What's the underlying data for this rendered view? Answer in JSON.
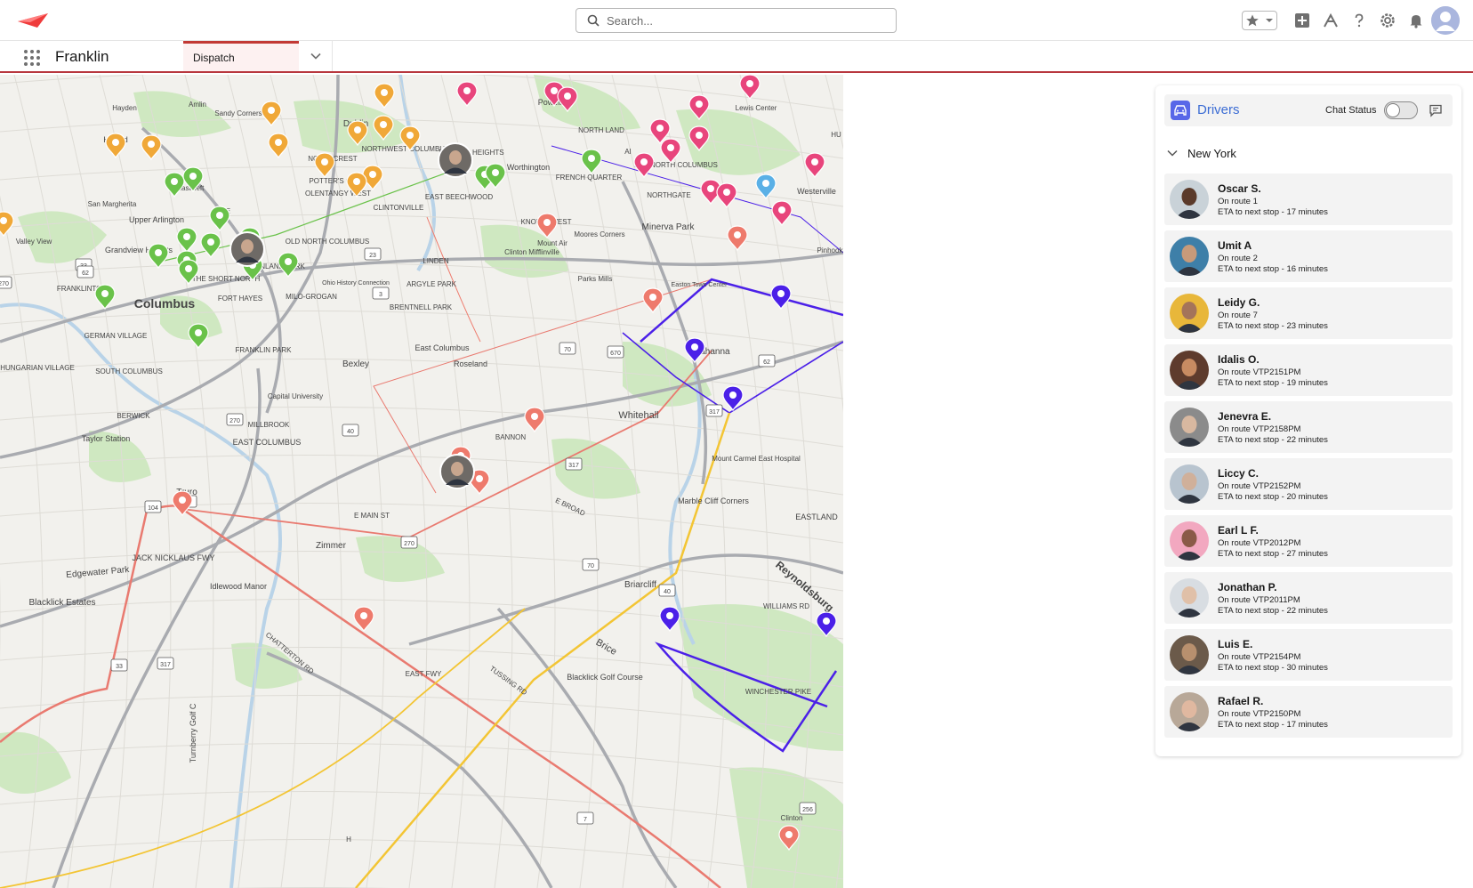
{
  "header": {
    "search_placeholder": "Search...",
    "icons": [
      "star-icon",
      "chevron-down-icon",
      "add-icon",
      "trailhead-icon",
      "help-icon",
      "gear-icon",
      "bell-icon",
      "user-avatar-icon"
    ]
  },
  "app": {
    "name": "Franklin",
    "active_tab": "Dispatch"
  },
  "map": {
    "labels": [
      {
        "text": "Hayden",
        "size": 8
      },
      {
        "text": "Amlin",
        "size": 8
      },
      {
        "text": "Sandy Corners",
        "size": 8
      },
      {
        "text": "Dublin",
        "size": 10
      },
      {
        "text": "Powell",
        "size": 9
      },
      {
        "text": "Lewis Center",
        "size": 8
      },
      {
        "text": "Hilliard",
        "size": 9
      },
      {
        "text": "Eastcleft",
        "size": 8
      },
      {
        "text": "NORTHWEST COLUMBUS",
        "size": 8
      },
      {
        "text": "Worthington",
        "size": 9
      },
      {
        "text": "FAR NORTH COLUMBUS",
        "size": 8
      },
      {
        "text": "Westerville",
        "size": 9
      },
      {
        "text": "San Margherita",
        "size": 8
      },
      {
        "text": "Upper Arlington",
        "size": 9
      },
      {
        "text": "OLENTANGY WEST",
        "size": 8
      },
      {
        "text": "CLINTONVILLE",
        "size": 8
      },
      {
        "text": "EAST BEECHWOOD",
        "size": 8
      },
      {
        "text": "FRENCH QUARTER",
        "size": 8
      },
      {
        "text": "NORTHGATE",
        "size": 8
      },
      {
        "text": "Minerva Park",
        "size": 10
      },
      {
        "text": "Valley View",
        "size": 8
      },
      {
        "text": "Grandview Heights",
        "size": 9
      },
      {
        "text": "OLD NORTH COLUMBUS",
        "size": 8
      },
      {
        "text": "LINDEN",
        "size": 8
      },
      {
        "text": "Clinton Mifflinville",
        "size": 8
      },
      {
        "text": "Moores Corners",
        "size": 8
      },
      {
        "text": "Pinhook",
        "size": 8
      },
      {
        "text": "FRANKLINTON",
        "size": 8
      },
      {
        "text": "THE SHORT NORTH",
        "size": 8
      },
      {
        "text": "WEINLAND PARK",
        "size": 8
      },
      {
        "text": "Ohio History Connection",
        "size": 7
      },
      {
        "text": "ARGYLE PARK",
        "size": 8
      },
      {
        "text": "Parks Mills",
        "size": 8
      },
      {
        "text": "Easton Town Center",
        "size": 7
      },
      {
        "text": "Columbus",
        "size": 14
      },
      {
        "text": "FORT HAYES",
        "size": 8
      },
      {
        "text": "MILO-GROGAN",
        "size": 8
      },
      {
        "text": "BRENTNELL PARK",
        "size": 8
      },
      {
        "text": "Gahanna",
        "size": 10
      },
      {
        "text": "GERMAN VILLAGE",
        "size": 8
      },
      {
        "text": "HUNGARIAN VILLAGE",
        "size": 8
      },
      {
        "text": "SOUTH COLUMBUS",
        "size": 8
      },
      {
        "text": "FRANKLIN PARK",
        "size": 8
      },
      {
        "text": "Bexley",
        "size": 10
      },
      {
        "text": "East Columbus",
        "size": 9
      },
      {
        "text": "Roseland",
        "size": 9
      },
      {
        "text": "Capital University",
        "size": 8
      },
      {
        "text": "MILLBROOK",
        "size": 8
      },
      {
        "text": "BERWICK",
        "size": 8
      },
      {
        "text": "EAST COLUMBUS",
        "size": 9
      },
      {
        "text": "Whitehall",
        "size": 11
      },
      {
        "text": "BANNON",
        "size": 8
      },
      {
        "text": "Taylor Station",
        "size": 9
      },
      {
        "text": "Mount Carmel East Hospital",
        "size": 8
      },
      {
        "text": "Marble Cliff Corners",
        "size": 9
      },
      {
        "text": "Truro",
        "size": 10
      },
      {
        "text": "E MAIN ST",
        "size": 8
      },
      {
        "text": "E BROAD",
        "size": 8
      },
      {
        "text": "EASTLAND",
        "size": 9
      },
      {
        "text": "Zimmer",
        "size": 10
      },
      {
        "text": "JACK NICKLAUS FWY",
        "size": 9
      },
      {
        "text": "Edgewater Park",
        "size": 10
      },
      {
        "text": "Idlewood Manor",
        "size": 9
      },
      {
        "text": "Briarcliff",
        "size": 10
      },
      {
        "text": "Reynoldsburg",
        "size": 12
      },
      {
        "text": "WILLIAMS RD",
        "size": 8
      },
      {
        "text": "Blacklick Estates",
        "size": 10
      },
      {
        "text": "CHATTERTON RD",
        "size": 8
      },
      {
        "text": "EAST FWY",
        "size": 8
      },
      {
        "text": "Brice",
        "size": 11
      },
      {
        "text": "TUSSING RD",
        "size": 8
      },
      {
        "text": "Blacklick Golf Course",
        "size": 9
      },
      {
        "text": "WINCHESTER PIKE",
        "size": 8
      },
      {
        "text": "Turnberry Golf C",
        "size": 9
      },
      {
        "text": "Clinton",
        "size": 8
      },
      {
        "text": "Mount Air",
        "size": 8
      },
      {
        "text": "NORTH LAND",
        "size": 8
      },
      {
        "text": "KNOLLS WEST",
        "size": 8
      },
      {
        "text": "NORTHCREST",
        "size": 8
      },
      {
        "text": "POTTER'S CREEK",
        "size": 8
      },
      {
        "text": "BRIXTON HEIGHTS",
        "size": 8
      },
      {
        "text": "FIRE",
        "size": 8
      },
      {
        "text": "AI",
        "size": 8
      },
      {
        "text": "HU",
        "size": 8
      },
      {
        "text": "H",
        "size": 8
      }
    ],
    "shields": [
      "33",
      "62",
      "270",
      "23",
      "3",
      "70",
      "670",
      "62",
      "270",
      "40",
      "317",
      "104",
      "33",
      "317",
      "33",
      "70",
      "256",
      "7",
      "40",
      "317",
      "270"
    ],
    "pin_colors": {
      "orange": "#f0a838",
      "green": "#6ac24a",
      "pink": "#e8457c",
      "coral": "#ee7a6c",
      "blue": "#4b20e8",
      "cyan": "#5ab0e6"
    }
  },
  "drivers_panel": {
    "title": "Drivers",
    "chat_status_label": "Chat Status",
    "chat_status_on": false,
    "group": "New York",
    "drivers": [
      {
        "name": "Oscar S.",
        "route": "On route 1",
        "eta": "ETA to next stop - 17 minutes",
        "avatar_bg": "#c9d2d8",
        "skin": "#5a3a2a"
      },
      {
        "name": "Umit A",
        "route": "On route 2",
        "eta": "ETA to next stop - 16 minutes",
        "avatar_bg": "#3e7fa8",
        "skin": "#c79a7a"
      },
      {
        "name": "Leidy G.",
        "route": "On route 7",
        "eta": "ETA to next stop - 23 minutes",
        "avatar_bg": "#e8b73a",
        "skin": "#a4745a"
      },
      {
        "name": "Idalis O.",
        "route": "On route VTP2151PM",
        "eta": "ETA to next stop - 19 minutes",
        "avatar_bg": "#5e3b2d",
        "skin": "#c88b62"
      },
      {
        "name": "Jenevra E.",
        "route": "On route VTP2158PM",
        "eta": "ETA to next stop - 22 minutes",
        "avatar_bg": "#8b8b8b",
        "skin": "#d8b8a0"
      },
      {
        "name": "Liccy C.",
        "route": "On route VTP2152PM",
        "eta": "ETA to next stop - 20 minutes",
        "avatar_bg": "#b8c4cf",
        "skin": "#d0b09a"
      },
      {
        "name": "Earl L F.",
        "route": "On route VTP2012PM",
        "eta": "ETA to next stop - 27 minutes",
        "avatar_bg": "#f2a8c0",
        "skin": "#8a5a48"
      },
      {
        "name": "Jonathan P.",
        "route": "On route VTP2011PM",
        "eta": "ETA to next stop - 22 minutes",
        "avatar_bg": "#d8dde2",
        "skin": "#e0c0a8"
      },
      {
        "name": "Luis E.",
        "route": "On route VTP2154PM",
        "eta": "ETA to next stop - 30 minutes",
        "avatar_bg": "#6b5a4a",
        "skin": "#b8906e"
      },
      {
        "name": "Rafael R.",
        "route": "On route VTP2150PM",
        "eta": "ETA to next stop - 17 minutes",
        "avatar_bg": "#b8a898",
        "skin": "#e0b8a0"
      }
    ]
  },
  "colors": {
    "accent_blue": "#3b6cd4",
    "brand_red": "#c23934",
    "tab_bg": "#fdf1f1"
  }
}
